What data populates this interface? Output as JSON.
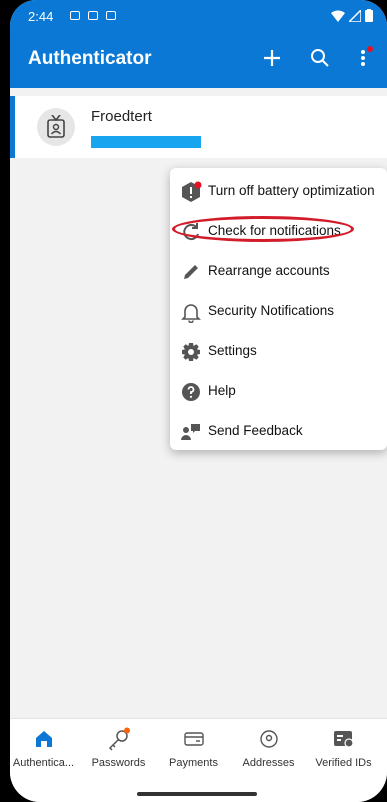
{
  "status_bar": {
    "time": "2:44",
    "icons": [
      "notification-icon-a",
      "notification-icon-b",
      "notification-icon-c",
      "wifi-icon",
      "signal-icon",
      "battery-icon"
    ]
  },
  "app_bar": {
    "title": "Authenticator",
    "actions": [
      "add-icon",
      "search-icon",
      "more-vert-icon"
    ],
    "colors": {
      "primary": "#0a78d4",
      "badge": "#e81123"
    }
  },
  "account": {
    "name": "Froedtert",
    "icon": "id-badge-icon"
  },
  "menu": {
    "items": [
      {
        "label": "Turn off battery optimization",
        "icon": "battery-warning-icon"
      },
      {
        "label": "Check for notifications",
        "icon": "refresh-icon"
      },
      {
        "label": "Rearrange accounts",
        "icon": "pencil-icon"
      },
      {
        "label": "Security Notifications",
        "icon": "bell-icon"
      },
      {
        "label": "Settings",
        "icon": "gear-icon"
      },
      {
        "label": "Help",
        "icon": "help-icon"
      },
      {
        "label": "Send Feedback",
        "icon": "feedback-icon"
      }
    ],
    "highlight_color": "#d21c2a"
  },
  "bottom_nav": {
    "items": [
      {
        "label": "Authentica...",
        "icon": "home-icon",
        "active": true
      },
      {
        "label": "Passwords",
        "icon": "key-icon"
      },
      {
        "label": "Payments",
        "icon": "card-icon"
      },
      {
        "label": "Addresses",
        "icon": "location-icon"
      },
      {
        "label": "Verified IDs",
        "icon": "verified-id-icon"
      }
    ]
  }
}
